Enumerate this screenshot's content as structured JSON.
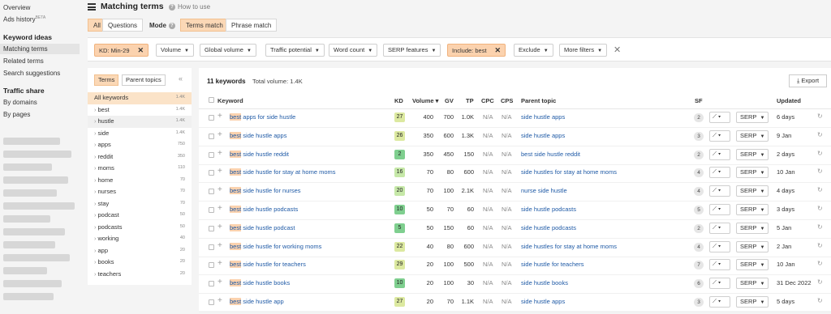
{
  "nav": {
    "overview": "Overview",
    "ads_history": "Ads history",
    "ads_history_badge": "BETA",
    "keyword_ideas_heading": "Keyword ideas",
    "matching_terms": "Matching terms",
    "related_terms": "Related terms",
    "search_suggestions": "Search suggestions",
    "traffic_share_heading": "Traffic share",
    "by_domains": "By domains",
    "by_pages": "By pages"
  },
  "header": {
    "title": "Matching terms",
    "how_to_use": "How to use",
    "tabs": [
      "All",
      "Questions"
    ],
    "mode_label": "Mode",
    "mode_options": [
      "Terms match",
      "Phrase match"
    ]
  },
  "filters": [
    {
      "label": "KD: Min-29",
      "active": true
    },
    {
      "label": "Volume",
      "active": false
    },
    {
      "label": "Global volume",
      "active": false
    },
    {
      "label": "Traffic potential",
      "active": false
    },
    {
      "label": "Word count",
      "active": false
    },
    {
      "label": "SERP features",
      "active": false
    },
    {
      "label": "Include: best",
      "active": true
    },
    {
      "label": "Exclude",
      "active": false
    },
    {
      "label": "More filters",
      "active": false
    }
  ],
  "sidebar": {
    "tabs": [
      "Terms",
      "Parent topics"
    ],
    "items": [
      {
        "label": "All keywords",
        "count": "1.4K"
      },
      {
        "label": "best",
        "count": "1.4K"
      },
      {
        "label": "hustle",
        "count": "1.4K"
      },
      {
        "label": "side",
        "count": "1.4K"
      },
      {
        "label": "apps",
        "count": "750"
      },
      {
        "label": "reddit",
        "count": "350"
      },
      {
        "label": "moms",
        "count": "110"
      },
      {
        "label": "home",
        "count": "70"
      },
      {
        "label": "nurses",
        "count": "70"
      },
      {
        "label": "stay",
        "count": "70"
      },
      {
        "label": "podcast",
        "count": "50"
      },
      {
        "label": "podcasts",
        "count": "50"
      },
      {
        "label": "working",
        "count": "40"
      },
      {
        "label": "app",
        "count": "20"
      },
      {
        "label": "books",
        "count": "20"
      },
      {
        "label": "teachers",
        "count": "20"
      }
    ]
  },
  "results": {
    "title": "11 keywords",
    "total_volume": "Total volume: 1.4K",
    "export": "Export",
    "columns": [
      "Keyword",
      "KD",
      "Volume",
      "GV",
      "TP",
      "CPC",
      "CPS",
      "Parent topic",
      "SF",
      "Updated"
    ],
    "rows": [
      {
        "hi": "best",
        "rest": " apps for side hustle",
        "kd": "27",
        "vol": "400",
        "gv": "700",
        "tp": "1.0K",
        "cpc": "N/A",
        "cps": "N/A",
        "parent": "side hustle apps",
        "sf": "2",
        "updated": "6 days"
      },
      {
        "hi": "best",
        "rest": " side hustle apps",
        "kd": "26",
        "vol": "350",
        "gv": "600",
        "tp": "1.3K",
        "cpc": "N/A",
        "cps": "N/A",
        "parent": "side hustle apps",
        "sf": "3",
        "updated": "9 Jan"
      },
      {
        "hi": "best",
        "rest": " side hustle reddit",
        "kd": "2",
        "vol": "350",
        "gv": "450",
        "tp": "150",
        "cpc": "N/A",
        "cps": "N/A",
        "parent": "best side hustle reddit",
        "sf": "2",
        "updated": "2 days"
      },
      {
        "hi": "best",
        "rest": " side hustle for stay at home moms",
        "kd": "16",
        "vol": "70",
        "gv": "80",
        "tp": "600",
        "cpc": "N/A",
        "cps": "N/A",
        "parent": "side hustles for stay at home moms",
        "sf": "4",
        "updated": "10 Jan"
      },
      {
        "hi": "best",
        "rest": " side hustle for nurses",
        "kd": "20",
        "vol": "70",
        "gv": "100",
        "tp": "2.1K",
        "cpc": "N/A",
        "cps": "N/A",
        "parent": "nurse side hustle",
        "sf": "4",
        "updated": "4 days"
      },
      {
        "hi": "best",
        "rest": " side hustle podcasts",
        "kd": "10",
        "vol": "50",
        "gv": "70",
        "tp": "60",
        "cpc": "N/A",
        "cps": "N/A",
        "parent": "side hustle podcasts",
        "sf": "5",
        "updated": "3 days"
      },
      {
        "hi": "best",
        "rest": " side hustle podcast",
        "kd": "5",
        "vol": "50",
        "gv": "150",
        "tp": "60",
        "cpc": "N/A",
        "cps": "N/A",
        "parent": "side hustle podcasts",
        "sf": "2",
        "updated": "5 Jan"
      },
      {
        "hi": "best",
        "rest": " side hustle for working moms",
        "kd": "22",
        "vol": "40",
        "gv": "80",
        "tp": "600",
        "cpc": "N/A",
        "cps": "N/A",
        "parent": "side hustles for stay at home moms",
        "sf": "4",
        "updated": "2 Jan"
      },
      {
        "hi": "best",
        "rest": " side hustle for teachers",
        "kd": "29",
        "vol": "20",
        "gv": "100",
        "tp": "500",
        "cpc": "N/A",
        "cps": "N/A",
        "parent": "side hustle for teachers",
        "sf": "7",
        "updated": "10 Jan"
      },
      {
        "hi": "best",
        "rest": " side hustle books",
        "kd": "10",
        "vol": "20",
        "gv": "100",
        "tp": "30",
        "cpc": "N/A",
        "cps": "N/A",
        "parent": "side hustle books",
        "sf": "6",
        "updated": "31 Dec 2022"
      },
      {
        "hi": "best",
        "rest": " side hustle app",
        "kd": "27",
        "vol": "20",
        "gv": "70",
        "tp": "1.1K",
        "cpc": "N/A",
        "cps": "N/A",
        "parent": "side hustle apps",
        "sf": "3",
        "updated": "5 days"
      }
    ]
  },
  "serp_label": "SERP",
  "colors": {
    "accent_orange": "#fbd8b6",
    "link_blue": "#1f5aa6",
    "kd_green_dark": "#7fcf8f",
    "kd_green_light": "#c6e8a8",
    "kd_yellow_green": "#dce9a0"
  }
}
